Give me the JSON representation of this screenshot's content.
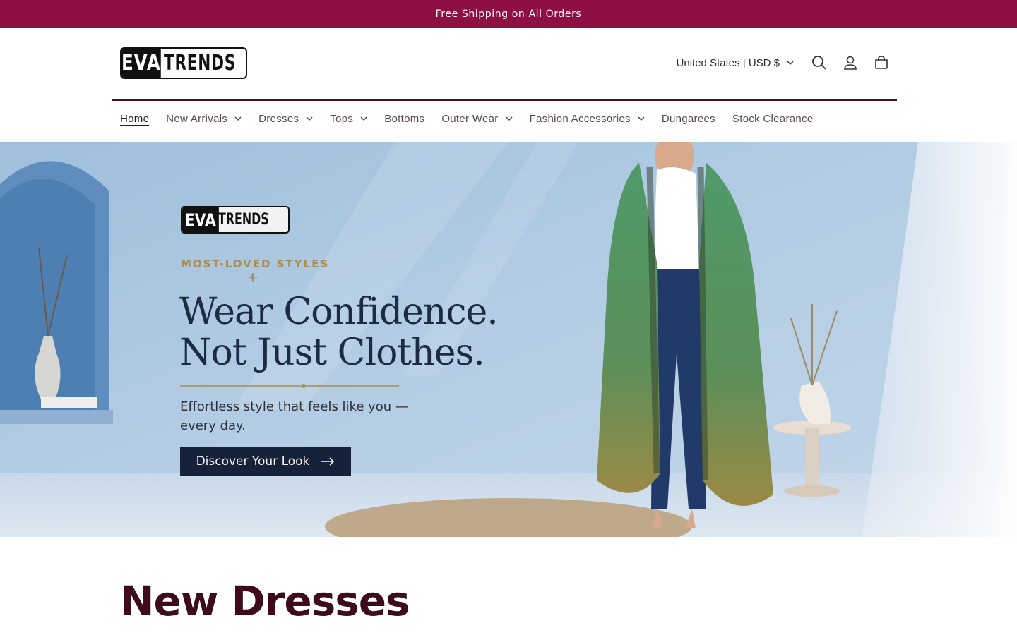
{
  "announcement": {
    "text": "Free Shipping on All Orders"
  },
  "header": {
    "logo": {
      "part1": "EVA",
      "part2": "TRENDS"
    },
    "country_selector": "United States | USD $",
    "icons": [
      "search-icon",
      "account-icon",
      "cart-icon"
    ]
  },
  "nav": {
    "items": [
      {
        "label": "Home",
        "active": true,
        "dropdown": false
      },
      {
        "label": "New Arrivals",
        "dropdown": true
      },
      {
        "label": "Dresses",
        "dropdown": true
      },
      {
        "label": "Tops",
        "dropdown": true
      },
      {
        "label": "Bottoms",
        "dropdown": false
      },
      {
        "label": "Outer Wear",
        "dropdown": true
      },
      {
        "label": "Fashion Accessories",
        "dropdown": true
      },
      {
        "label": "Dungarees",
        "dropdown": false
      },
      {
        "label": "Stock Clearance",
        "dropdown": false
      }
    ]
  },
  "hero": {
    "logo": {
      "part1": "EVA",
      "part2": "TRENDS"
    },
    "eyebrow": "MOST-LOVED STYLES",
    "headline_line1": "Wear Confidence.",
    "headline_line2": "Not Just Clothes.",
    "subtext_line1": "Effortless style that feels like you —",
    "subtext_line2": "every day.",
    "cta_label": "Discover Your Look"
  },
  "section": {
    "title": "New Dresses"
  },
  "colors": {
    "announcement_bg": "#8e0f43",
    "divider": "#4a1026",
    "hero_cta_bg": "#16223a",
    "section_title": "#3e0b1c",
    "eyebrow": "#a98d52"
  }
}
